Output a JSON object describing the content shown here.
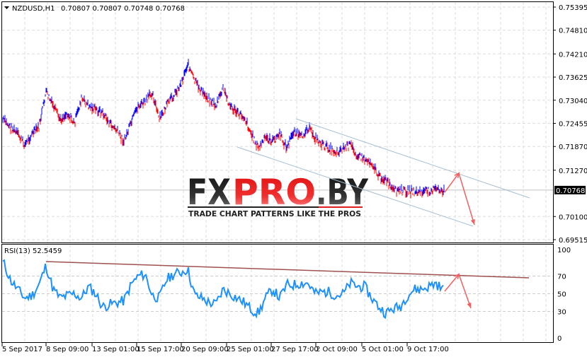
{
  "header": {
    "symbol": "NZDUSD,H1",
    "ohlc": "0.70807 0.70807 0.70748 0.70768"
  },
  "rsi_header": "RSI(13) 52.5459",
  "watermark": {
    "logo": "FXPRO.BY",
    "tagline": "TRADE CHART PATTERNS LIKE THE PROS"
  },
  "colors": {
    "up": "#0000ff",
    "down": "#ff0000",
    "rsi": "#1e90ff",
    "channel": "#a7bfd0",
    "rsi_trend": "#a05050",
    "arrow": "#f06060"
  },
  "chart_data": [
    {
      "type": "bar",
      "title": "NZDUSD,H1",
      "ylim": [
        0.69515,
        0.75395
      ],
      "yticks": [
        "0.75395",
        "0.74810",
        "0.74210",
        "0.73625",
        "0.73040",
        "0.72455",
        "0.71870",
        "0.71270",
        "0.70100",
        "0.69515"
      ],
      "ytick_values": [
        0.75395,
        0.7481,
        0.7421,
        0.73625,
        0.7304,
        0.72455,
        0.7187,
        0.7127,
        0.701,
        0.69515
      ],
      "current_price": "0.70768",
      "current_price_value": 0.70768,
      "xticks": [
        "5 Sep 2017",
        "8 Sep 09:00",
        "13 Sep 01:00",
        "15 Sep 17:00",
        "20 Sep 09:00",
        "25 Sep 01:00",
        "27 Sep 17:00",
        "2 Oct 09:00",
        "5 Oct 01:00",
        "9 Oct 17:00"
      ],
      "close_approx": [
        0.72536,
        0.72357,
        0.72178,
        0.7191,
        0.72178,
        0.72357,
        0.73251,
        0.72893,
        0.72536,
        0.72714,
        0.72446,
        0.73072,
        0.72893,
        0.72804,
        0.72714,
        0.72446,
        0.72268,
        0.72,
        0.72446,
        0.72893,
        0.72983,
        0.73251,
        0.72536,
        0.72893,
        0.73161,
        0.73429,
        0.73965,
        0.73518,
        0.73251,
        0.73072,
        0.72893,
        0.7334,
        0.72893,
        0.72714,
        0.72625,
        0.72178,
        0.71821,
        0.72089,
        0.72,
        0.72178,
        0.71821,
        0.72268,
        0.72089,
        0.72357,
        0.72089,
        0.7191,
        0.71821,
        0.71732,
        0.71821,
        0.7191,
        0.71642,
        0.71553,
        0.71464,
        0.71106,
        0.71017,
        0.70749,
        0.70749,
        0.70749,
        0.70713,
        0.70713,
        0.70749,
        0.70785,
        0.70749
      ]
    },
    {
      "type": "line",
      "title": "RSI(13) 52.5459",
      "ylim": [
        0,
        100
      ],
      "yticks": [
        "100",
        "70",
        "50",
        "30",
        "0"
      ],
      "ytick_values": [
        100,
        70,
        50,
        30,
        0
      ],
      "values": [
        85,
        65,
        55,
        45,
        48,
        60,
        82,
        55,
        45,
        48,
        50,
        45,
        58,
        50,
        35,
        38,
        40,
        42,
        60,
        70,
        72,
        48,
        45,
        66,
        72,
        74,
        78,
        48,
        45,
        40,
        38,
        55,
        50,
        45,
        40,
        32,
        28,
        45,
        55,
        45,
        60,
        60,
        62,
        62,
        50,
        52,
        52,
        48,
        50,
        62,
        58,
        58,
        45,
        35,
        28,
        33,
        35,
        48,
        55,
        55,
        58,
        62,
        55
      ]
    }
  ]
}
